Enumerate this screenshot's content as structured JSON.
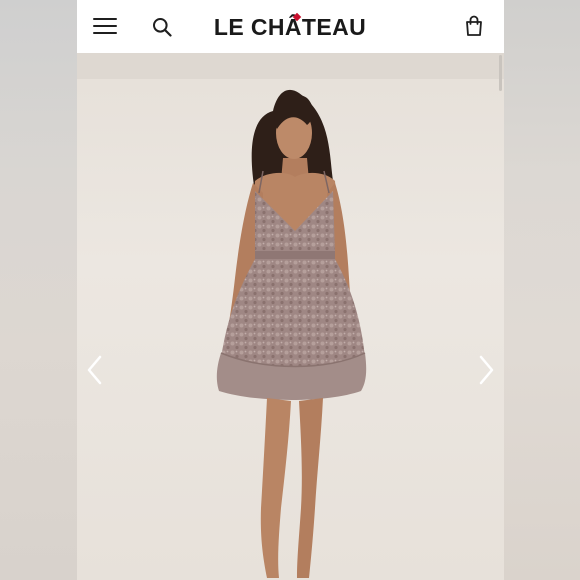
{
  "header": {
    "brand": "LE CHÂTEAU",
    "icons": {
      "menu": "hamburger-menu-icon",
      "search": "search-icon",
      "cart": "shopping-bag-icon"
    }
  },
  "gallery": {
    "image_subject": "model-in-lace-dress",
    "controls": {
      "previous": "chevron-left-icon",
      "next": "chevron-right-icon"
    }
  },
  "colors": {
    "header_bg": "#ffffff",
    "page_bg": "#ebe6e0",
    "brand_accent": "#c8102e",
    "dress": "#9d8683",
    "skin": "#b98564",
    "hair": "#2e1f18"
  }
}
